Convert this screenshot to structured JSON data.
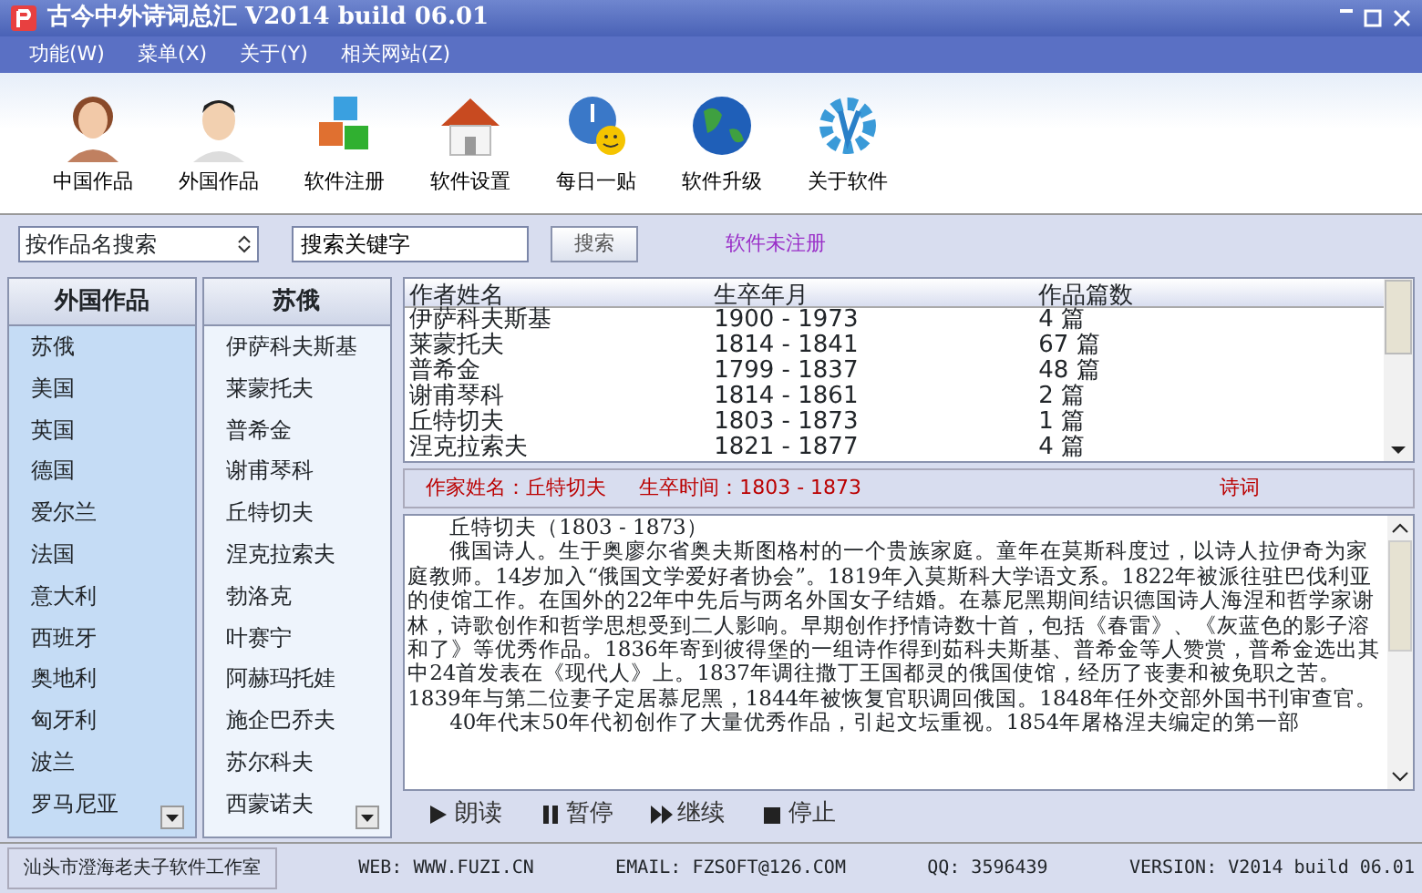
{
  "window": {
    "title": "古今中外诗词总汇 V2014 build 06.01"
  },
  "menu": [
    "功能(W)",
    "菜单(X)",
    "关于(Y)",
    "相关网站(Z)"
  ],
  "toolbar": [
    {
      "label": "中国作品",
      "kind": "woman"
    },
    {
      "label": "外国作品",
      "kind": "man"
    },
    {
      "label": "软件注册",
      "kind": "cubes"
    },
    {
      "label": "软件设置",
      "kind": "house"
    },
    {
      "label": "每日一贴",
      "kind": "chat"
    },
    {
      "label": "软件升级",
      "kind": "globe"
    },
    {
      "label": "关于软件",
      "kind": "gear"
    }
  ],
  "search": {
    "mode": "按作品名搜索",
    "keyword": "搜索关键字",
    "button": "搜索",
    "status": "软件未注册"
  },
  "countries": {
    "header": "外国作品",
    "items": [
      "苏俄",
      "美国",
      "英国",
      "德国",
      "爱尔兰",
      "法国",
      "意大利",
      "西班牙",
      "奥地利",
      "匈牙利",
      "波兰",
      "罗马尼亚"
    ]
  },
  "authors": {
    "header": "苏俄",
    "items": [
      "伊萨科夫斯基",
      "莱蒙托夫",
      "普希金",
      "谢甫琴科",
      "丘特切夫",
      "涅克拉索夫",
      "勃洛克",
      "叶赛宁",
      "阿赫玛托娃",
      "施企巴乔夫",
      "苏尔科夫",
      "西蒙诺夫"
    ]
  },
  "table": {
    "columns": [
      "作者姓名",
      "生卒年月",
      "作品篇数"
    ],
    "rows": [
      [
        "伊萨科夫斯基",
        "1900 - 1973",
        "4 篇"
      ],
      [
        "莱蒙托夫",
        "1814 - 1841",
        "67 篇"
      ],
      [
        "普希金",
        "1799 - 1837",
        "48 篇"
      ],
      [
        "谢甫琴科",
        "1814 - 1861",
        "2 篇"
      ],
      [
        "丘特切夫",
        "1803 - 1873",
        "1 篇"
      ],
      [
        "涅克拉索夫",
        "1821 - 1877",
        "4 篇"
      ]
    ]
  },
  "info": {
    "name": "作家姓名：丘特切夫",
    "years": "生卒时间：1803 - 1873",
    "genre": "诗词"
  },
  "text": [
    "丘特切夫（1803 - 1873）",
    "俄国诗人。生于奥廖尔省奥夫斯图格村的一个贵族家庭。童年在莫斯科度过，以诗人拉伊奇为家庭教师。14岁加入“俄国文学爱好者协会”。1819年入莫斯科大学语文系。1822年被派往驻巴伐利亚的使馆工作。在国外的22年中先后与两名外国女子结婚。在慕尼黑期间结识德国诗人海涅和哲学家谢林，诗歌创作和哲学思想受到二人影响。早期创作抒情诗数十首，包括《春雷》、《灰蓝色的影子溶和了》等优秀作品。1836年寄到彼得堡的一组诗作得到茹科夫斯基、普希金等人赞赏，普希金选出其中24首发表在《现代人》上。1837年调往撒丁王国都灵的俄国使馆，经历了丧妻和被免职之苦。1839年与第二位妻子定居慕尼黑，1844年被恢复官职调回俄国。1848年任外交部外国书刊审查官。",
    "40年代末50年代初创作了大量优秀作品，引起文坛重视。1854年屠格涅夫编定的第一部"
  ],
  "player": [
    {
      "label": "朗读",
      "kind": "play"
    },
    {
      "label": "暂停",
      "kind": "pause"
    },
    {
      "label": "继续",
      "kind": "resume"
    },
    {
      "label": "停止",
      "kind": "stop"
    }
  ],
  "status_bar": [
    "汕头市澄海老夫子软件工作室",
    "WEB: WWW.FUZI.CN",
    "EMAIL: FZSOFT@126.COM",
    "QQ: 3596439",
    "VERSION: V2014 build 06.01"
  ]
}
